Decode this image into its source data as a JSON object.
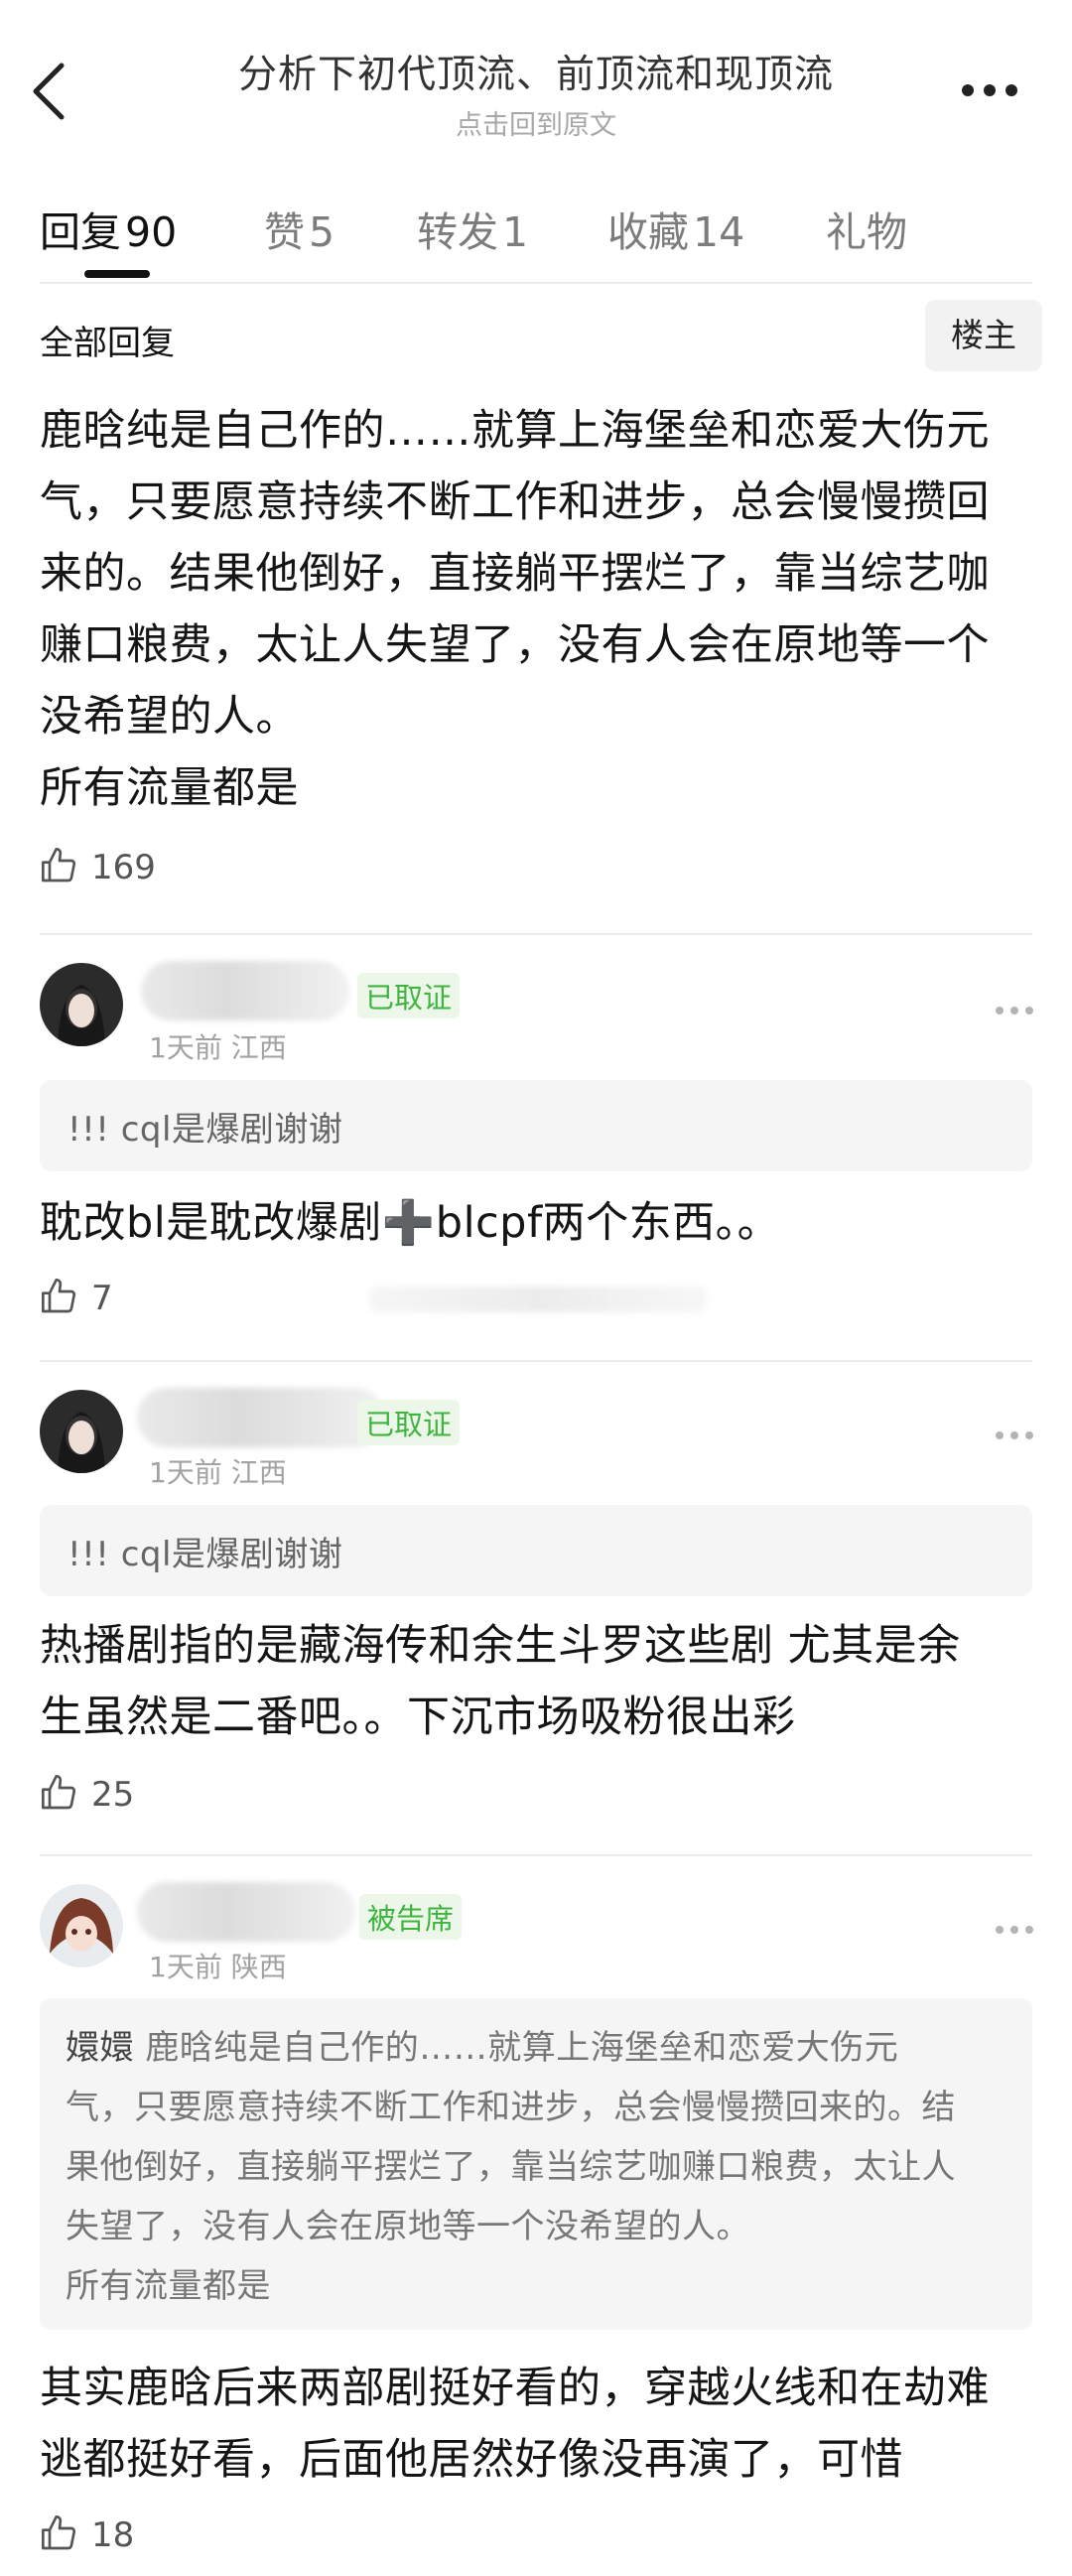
{
  "header": {
    "title": "分析下初代顶流、前顶流和现顶流",
    "subtitle": "点击回到原文"
  },
  "tabs": [
    {
      "label": "回复",
      "count": "90",
      "active": true
    },
    {
      "label": "赞",
      "count": "5"
    },
    {
      "label": "转发",
      "count": "1"
    },
    {
      "label": "收藏",
      "count": "14"
    },
    {
      "label": "礼物",
      "count": ""
    }
  ],
  "all_replies_label": "全部回复",
  "op_button_label": "楼主",
  "main_post": {
    "lines": [
      "鹿晗纯是自己作的……就算上海堡垒和恋爱大伤元",
      "气，只要愿意持续不断工作和进步，总会慢慢攒回",
      "来的。结果他倒好，直接躺平摆烂了，靠当综艺咖",
      "赚口粮费，太让人失望了，没有人会在原地等一个",
      "没希望的人。",
      "所有流量都是"
    ],
    "likes": "169"
  },
  "replies": [
    {
      "badge": "已取证",
      "time": "1天前",
      "location": "江西",
      "quote": "!!!  cql是爆剧谢谢",
      "text": [
        "耽改bl是耽改爆剧➕blcpf两个东西。。"
      ],
      "likes": "7"
    },
    {
      "badge": "已取证",
      "time": "1天前",
      "location": "江西",
      "quote": "!!!  cql是爆剧谢谢",
      "text": [
        "热播剧指的是藏海传和余生斗罗这些剧 尤其是余",
        "生虽然是二番吧。。下沉市场吸粉很出彩"
      ],
      "likes": "25"
    },
    {
      "badge": "被告席",
      "time": "1天前",
      "location": "陕西",
      "quote_author": "嬛嬛",
      "quote_lines": [
        "鹿晗纯是自己作的……就算上海堡垒和恋爱大伤元",
        "气，只要愿意持续不断工作和进步，总会慢慢攒回来的。结",
        "果他倒好，直接躺平摆烂了，靠当综艺咖赚口粮费，太让人",
        "失望了，没有人会在原地等一个没希望的人。",
        "所有流量都是"
      ],
      "text": [
        "其实鹿晗后来两部剧挺好看的，穿越火线和在劫难",
        "逃都挺好看，后面他居然好像没再演了，可惜"
      ],
      "likes": "18"
    }
  ],
  "colors": {
    "accent_green": "#3fb43f",
    "divider": "#ececec"
  },
  "icons": [
    "back-arrow-icon",
    "more-dots-icon",
    "thumb-up-icon"
  ]
}
